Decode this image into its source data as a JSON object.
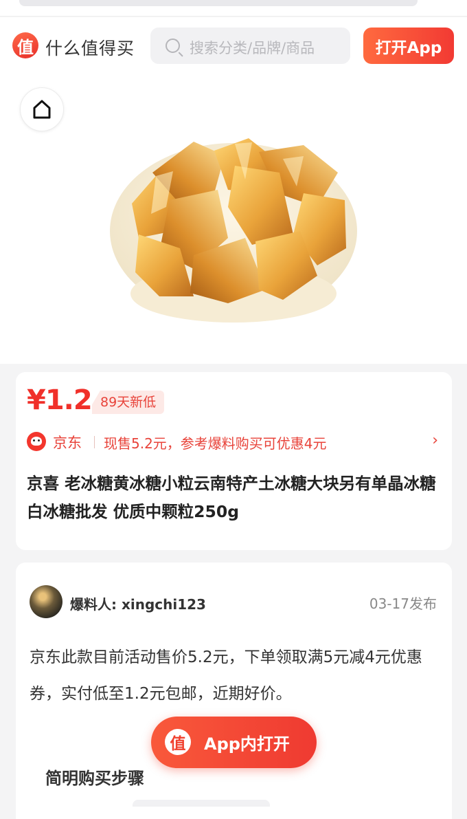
{
  "header": {
    "logo_glyph": "值",
    "brand": "什么值得买",
    "search_placeholder": "搜索分类/品牌/商品",
    "open_app": "打开App"
  },
  "product": {
    "price": "¥1.2",
    "price_badge": "89天新低",
    "store": "京东",
    "promo": "现售5.2元，参考爆料购买可优惠4元",
    "title": "京喜 老冰糖黄冰糖小粒云南特产土冰糖大块另有单晶冰糖白冰糖批发 优质中颗粒250g"
  },
  "post": {
    "reporter": "爆料人: xingchi123",
    "date": "03-17发布",
    "body": "京东此款目前活动售价5.2元，下单领取满5元减4元优惠券，实付低至1.2元包邮，近期好价。",
    "steps_title": "简明购买步骤"
  },
  "float_button": {
    "logo_glyph": "值",
    "label": "App内打开"
  },
  "colors": {
    "accent": "#f0302a",
    "brand_gradient_start": "#ff6a3f",
    "brand_gradient_end": "#f23a33"
  },
  "icons": [
    "search-icon",
    "home-icon",
    "chevron-right-icon",
    "jd-store-icon"
  ]
}
